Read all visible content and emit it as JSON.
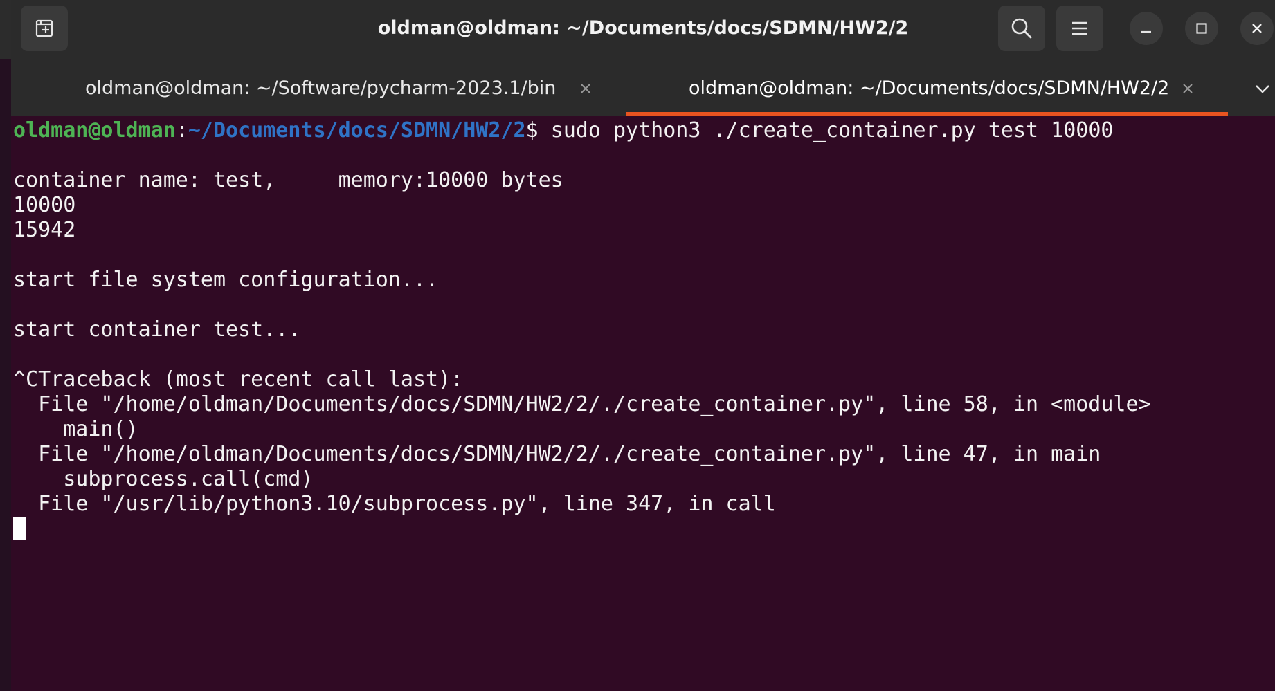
{
  "window": {
    "title": "oldman@oldman: ~/Documents/docs/SDMN/HW2/2"
  },
  "tabs": [
    {
      "label": "oldman@oldman: ~/Software/pycharm-2023.1/bin",
      "active": false
    },
    {
      "label": "oldman@oldman: ~/Documents/docs/SDMN/HW2/2",
      "active": true
    }
  ],
  "terminal": {
    "prompt_user": "oldman@oldman",
    "prompt_sep": ":",
    "prompt_path": "~/Documents/docs/SDMN/HW2/2",
    "prompt_symbol": "$ ",
    "command": "sudo python3 ./create_container.py test 10000",
    "output_lines": [
      "",
      "container name: test,     memory:10000 bytes",
      "10000",
      "15942",
      "",
      "start file system configuration...",
      "",
      "start container test...",
      "",
      "^CTraceback (most recent call last):",
      "  File \"/home/oldman/Documents/docs/SDMN/HW2/2/./create_container.py\", line 58, in <module>",
      "    main()",
      "  File \"/home/oldman/Documents/docs/SDMN/HW2/2/./create_container.py\", line 47, in main",
      "    subprocess.call(cmd)",
      "  File \"/usr/lib/python3.10/subprocess.py\", line 347, in call"
    ]
  },
  "colors": {
    "terminal_bg": "#300a24",
    "prompt_user": "#4eb354",
    "prompt_path": "#2f73c6",
    "tab_indicator": "#e95420",
    "headerbar_bg": "#2b2b2b"
  },
  "icons": {
    "new_tab": "new-tab-icon",
    "search": "search-icon",
    "menu": "hamburger-menu-icon",
    "minimize": "minimize-icon",
    "maximize": "maximize-icon",
    "close": "close-icon",
    "tab_close": "tab-close-icon",
    "tab_overflow": "chevron-down-icon"
  }
}
